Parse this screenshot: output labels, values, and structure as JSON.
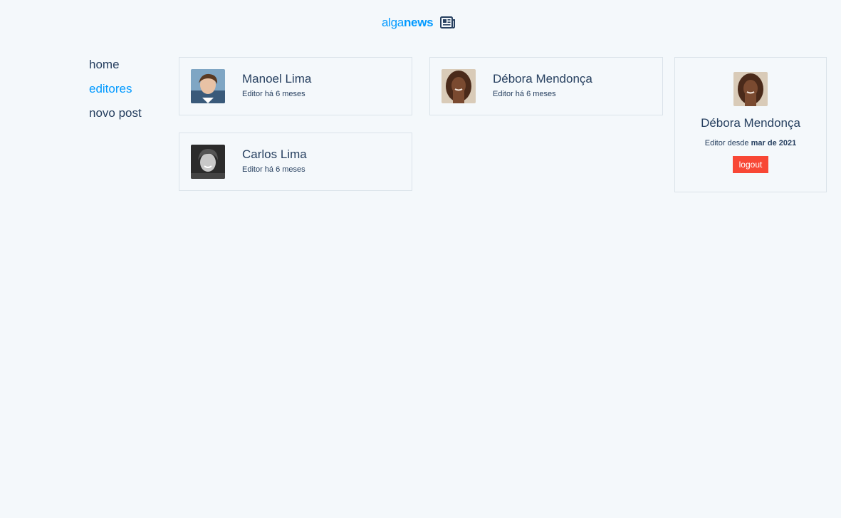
{
  "brand": {
    "prefix": "alga",
    "suffix": "news",
    "icon": "newspaper-icon",
    "color": "#0099ff"
  },
  "nav": {
    "items": [
      {
        "label": "home",
        "active": false
      },
      {
        "label": "editores",
        "active": true
      },
      {
        "label": "novo post",
        "active": false
      }
    ]
  },
  "editors": [
    {
      "name": "Manoel Lima",
      "subtitle": "Editor há 6 meses"
    },
    {
      "name": "Débora Mendonça",
      "subtitle": "Editor há 6 meses"
    },
    {
      "name": "Carlos Lima",
      "subtitle": "Editor há 6 meses"
    }
  ],
  "profile": {
    "name": "Débora Mendonça",
    "since_prefix": "Editor desde",
    "since_date": "mar de 2021",
    "logout_label": "logout"
  },
  "colors": {
    "accent": "#0099ff",
    "danger": "#f84735",
    "text": "#274060",
    "background": "#f4f8fb"
  }
}
